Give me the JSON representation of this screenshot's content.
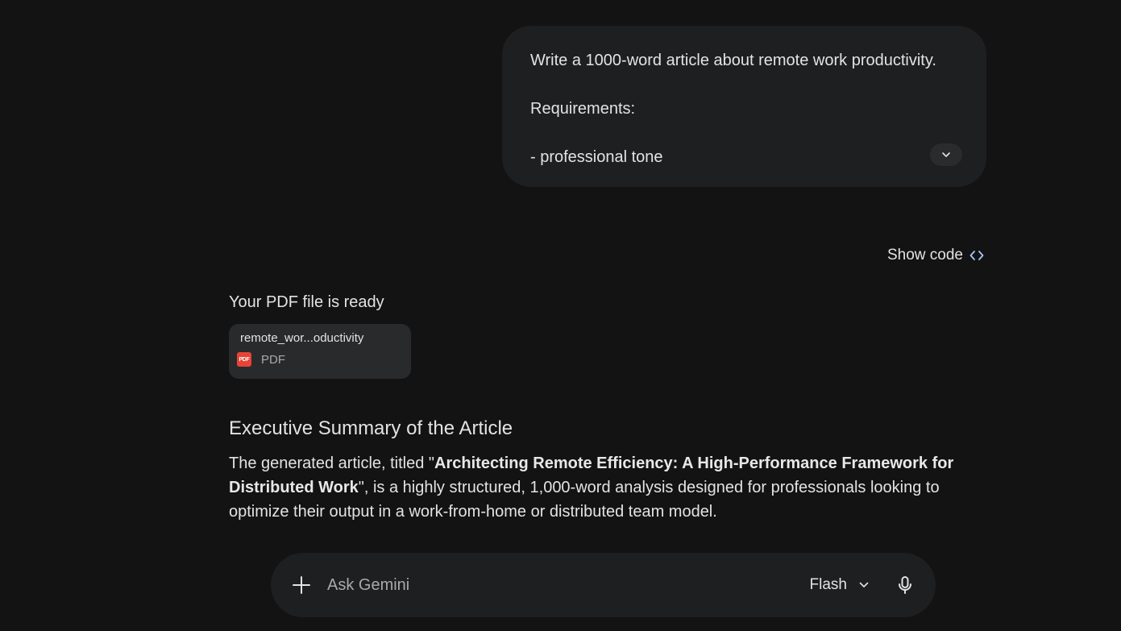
{
  "user_prompt": {
    "line1": "Write a 1000-word article about remote work productivity.",
    "line2": "Requirements:",
    "line3": "- professional tone",
    "expand_icon": "chevron-down-icon"
  },
  "response": {
    "show_code_label": "Show code",
    "show_code_icon": "code-icon",
    "pdf_ready_title": "Your PDF file is ready",
    "file": {
      "name": "remote_wor...oductivity",
      "type": "PDF",
      "badge": "PDF",
      "icon": "pdf-file-icon"
    },
    "summary_heading": "Executive Summary of the Article",
    "summary": {
      "before": "The generated article, titled \"",
      "bold": "Architecting Remote Efficiency: A High-Performance Framework for Distributed Work",
      "after": "\", is a highly structured, 1,000-word analysis designed for professionals looking to optimize their output in a work-from-home or distributed team model."
    }
  },
  "input_bar": {
    "placeholder": "Ask Gemini",
    "model_label": "Flash",
    "plus_icon": "plus-icon",
    "model_icon": "chevron-down-icon",
    "mic_icon": "microphone-icon"
  },
  "colors": {
    "background": "#131314",
    "surface": "#1e1f20",
    "card": "#282a2c",
    "text": "#e3e3e3",
    "muted": "#a8a9ab",
    "accent_blue": "#a8c7fa",
    "pdf_red": "#e84336"
  }
}
